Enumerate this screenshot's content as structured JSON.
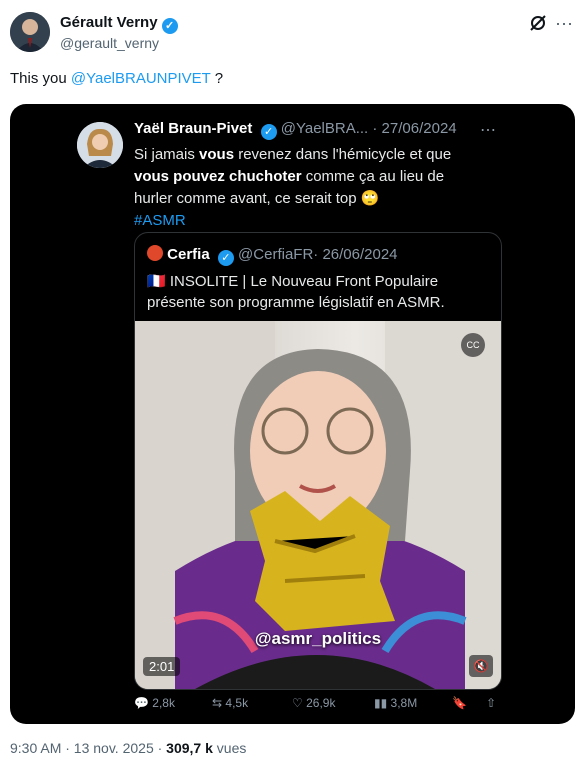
{
  "author": {
    "name": "Gérault Verny",
    "handle": "@gerault_verny"
  },
  "tweet": {
    "text": "This you ",
    "mention": "@YaelBRAUNPIVET",
    "suffix": " ?"
  },
  "quoted": {
    "name": "Yaël Braun-Pivet",
    "handle": "@YaelBRA...",
    "date": "· 27/06/2024",
    "text_parts": [
      "Si jamais ",
      "vous",
      " revenez dans l'hémicycle et que ",
      "vous pouvez chuchoter",
      " comme ça au lieu de hurler comme avant, ce serait top ",
      "🙄"
    ],
    "hashtag": "#ASMR"
  },
  "inner_quote": {
    "name": "Cerfia",
    "handle": "@CerfiaFR",
    "date": "· 26/06/2024",
    "flag": "🇫🇷",
    "text": "INSOLITE | Le Nouveau Front Populaire présente son programme législatif en ASMR."
  },
  "video": {
    "watermark": "@asmr_politics",
    "duration": "2:01"
  },
  "actions": {
    "replies": "2,8k",
    "retweets": "4,5k",
    "likes": "26,9k",
    "views": "3,8M"
  },
  "footer": {
    "time": "9:30 AM · 13 nov. 2025 · ",
    "views": "309,7 k",
    "views_label": " vues"
  }
}
